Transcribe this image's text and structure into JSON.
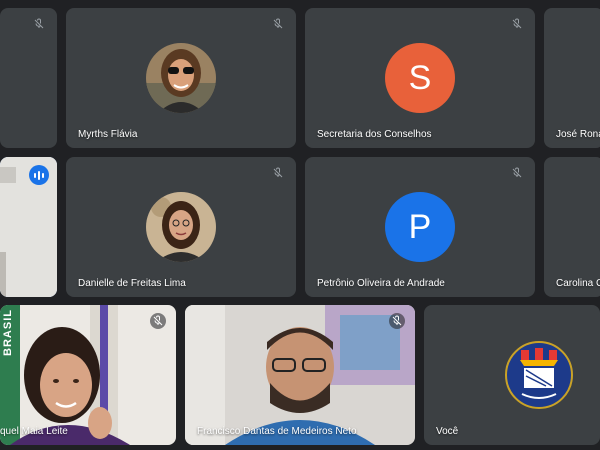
{
  "participants": {
    "myrths": {
      "name": "Myrths Flávia",
      "muted": true
    },
    "secretaria": {
      "name": "Secretaria dos Conselhos",
      "initial": "S",
      "avatar_color": "#e8613a",
      "muted": true
    },
    "jose": {
      "name": "José Ronal",
      "muted": true
    },
    "danielle": {
      "name": "Danielle de Freitas Lima",
      "muted": true
    },
    "petronio": {
      "name": "Petrônio Oliveira de Andrade",
      "initial": "P",
      "avatar_color": "#1a73e8",
      "muted": true
    },
    "carolina": {
      "name": "Carolina C",
      "muted": true
    },
    "raquel": {
      "name": "quel Maia Leite",
      "muted": true
    },
    "francisco": {
      "name": "Francisco Dantas de Medeiros Neto",
      "muted": true
    },
    "voce": {
      "name": "Você"
    }
  },
  "icons": {
    "muted": "mic-off-icon",
    "speaking": "audio-level-icon"
  },
  "banner_text": "BRASIL",
  "colors": {
    "tile_bg": "#3c4043",
    "page_bg": "#202124",
    "active_outline": "#8ab4f8"
  }
}
